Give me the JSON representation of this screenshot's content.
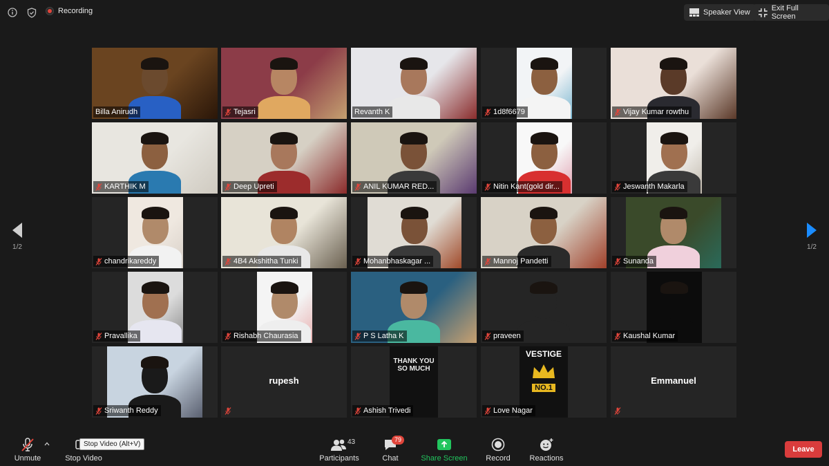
{
  "topbar": {
    "recording_label": "Recording",
    "speaker_view_label": "Speaker View",
    "exit_fullscreen_label": "Exit Full Screen"
  },
  "pager": {
    "left_label": "1/2",
    "right_label": "1/2",
    "accent": "#1a8cff"
  },
  "participants": [
    {
      "name": "Billa Anirudh",
      "muted": false,
      "video": true
    },
    {
      "name": "Tejasri",
      "muted": true,
      "video": true
    },
    {
      "name": "Revanth K",
      "muted": false,
      "video": true,
      "active_speaker": true
    },
    {
      "name": "1d8f6679",
      "muted": true,
      "video": true
    },
    {
      "name": "Vijay Kumar rowthu",
      "muted": true,
      "video": true
    },
    {
      "name": "KARTHIK M",
      "muted": true,
      "video": true
    },
    {
      "name": "Deep Upreti",
      "muted": true,
      "video": true
    },
    {
      "name": "ANIL KUMAR RED...",
      "muted": true,
      "video": true
    },
    {
      "name": "Nitin Kant(gold dir...",
      "muted": true,
      "video": true
    },
    {
      "name": "Jeswanth Makarla",
      "muted": true,
      "video": true
    },
    {
      "name": "chandrikareddy",
      "muted": true,
      "video": true
    },
    {
      "name": "4B4 Akshitha Tunki",
      "muted": true,
      "video": true
    },
    {
      "name": "Mohanbhaskagar ...",
      "muted": true,
      "video": true
    },
    {
      "name": "Mannoj Pandetti",
      "muted": true,
      "video": true
    },
    {
      "name": "Sunanda",
      "muted": true,
      "video": true
    },
    {
      "name": "Pravallika",
      "muted": true,
      "video": true
    },
    {
      "name": "Rishabh Chaurasia",
      "muted": true,
      "video": true
    },
    {
      "name": "P S Latha K",
      "muted": true,
      "video": true
    },
    {
      "name": "praveen",
      "muted": true,
      "video": true
    },
    {
      "name": "Kaushal Kumar",
      "muted": true,
      "video": true
    },
    {
      "name": "Sriwanth Reddy",
      "muted": true,
      "video": true
    },
    {
      "name": "",
      "display_name": "rupesh",
      "muted": true,
      "video": false
    },
    {
      "name": "Ashish Trivedi",
      "muted": true,
      "video": true,
      "image_text": "THANK YOU SO MUCH"
    },
    {
      "name": "Love Nagar",
      "muted": true,
      "video": true,
      "image_text": "VESTIGE",
      "image_subtext": "NO.1"
    },
    {
      "name": "",
      "display_name": "Emmanuel",
      "muted": true,
      "video": false
    }
  ],
  "controls": {
    "unmute_label": "Unmute",
    "stop_video_label": "Stop Video",
    "stop_video_tooltip": "Stop Video (Alt+V)",
    "participants_label": "Participants",
    "participants_count": "43",
    "chat_label": "Chat",
    "chat_badge": "79",
    "share_screen_label": "Share Screen",
    "record_label": "Record",
    "reactions_label": "Reactions",
    "leave_label": "Leave"
  },
  "colors": {
    "active_speaker_border": "#a6d65c",
    "share_screen_green": "#22c55e",
    "leave_red": "#d93c3c",
    "badge_red": "#e0453b"
  }
}
